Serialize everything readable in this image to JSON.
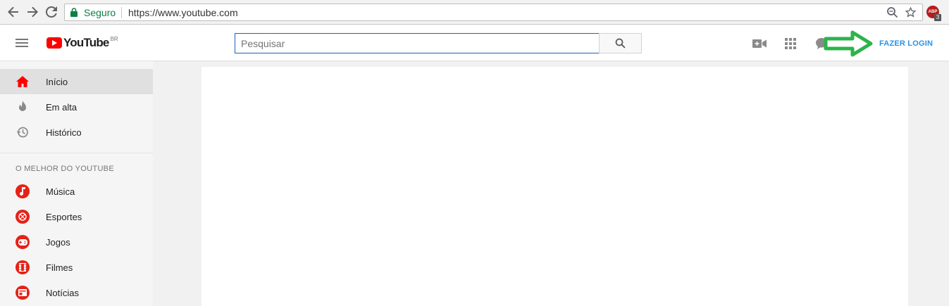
{
  "browser": {
    "secure_label": "Seguro",
    "url": "https://www.youtube.com",
    "extension_label": "ABP",
    "extension_badge": "3"
  },
  "masthead": {
    "logo_text": "YouTube",
    "logo_region": "BR",
    "search_placeholder": "Pesquisar",
    "login_label": "FAZER LOGIN",
    "login_color": "#2793e6",
    "annotation_arrow_color": "#2db34a"
  },
  "sidebar": {
    "items": [
      {
        "label": "Início",
        "icon": "home-icon",
        "active": true
      },
      {
        "label": "Em alta",
        "icon": "flame-icon"
      },
      {
        "label": "Histórico",
        "icon": "history-icon"
      }
    ],
    "section_heading": "O MELHOR DO YOUTUBE",
    "categories": [
      {
        "label": "Música",
        "icon": "music-icon"
      },
      {
        "label": "Esportes",
        "icon": "sports-icon"
      },
      {
        "label": "Jogos",
        "icon": "gamepad-icon"
      },
      {
        "label": "Filmes",
        "icon": "film-icon"
      },
      {
        "label": "Notícias",
        "icon": "news-icon"
      }
    ]
  },
  "colors": {
    "brand_red": "#ff0000",
    "category_red": "#e62117",
    "secure_green": "#0b8043"
  }
}
